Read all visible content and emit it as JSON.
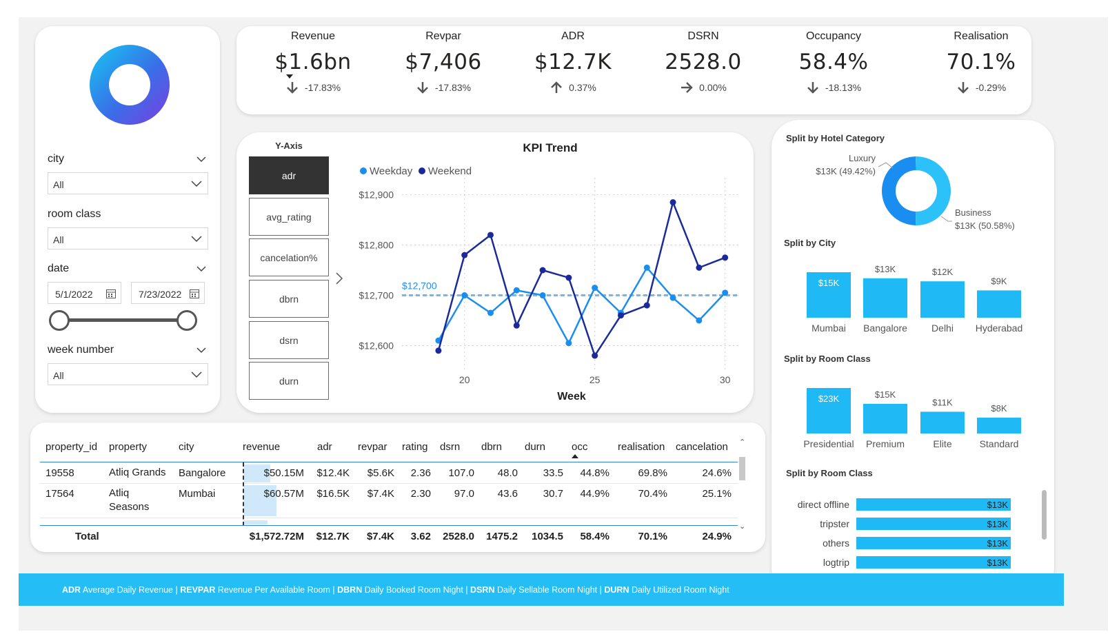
{
  "filters": {
    "city": {
      "label": "city",
      "value": "All"
    },
    "room_class": {
      "label": "room class",
      "value": "All"
    },
    "date": {
      "label": "date",
      "start": "5/1/2022",
      "end": "7/23/2022"
    },
    "week_number": {
      "label": "week number",
      "value": "All"
    }
  },
  "kpis": [
    {
      "title": "Revenue",
      "value": "$1.6bn",
      "delta": "-17.83%",
      "direction": "down"
    },
    {
      "title": "Revpar",
      "value": "$7,406",
      "delta": "-17.83%",
      "direction": "down"
    },
    {
      "title": "ADR",
      "value": "$12.7K",
      "delta": "0.37%",
      "direction": "up"
    },
    {
      "title": "DSRN",
      "value": "2528.0",
      "delta": "0.00%",
      "direction": "flat"
    },
    {
      "title": "Occupancy",
      "value": "58.4%",
      "delta": "-18.13%",
      "direction": "down"
    },
    {
      "title": "Realisation",
      "value": "70.1%",
      "delta": "-0.29%",
      "direction": "down"
    }
  ],
  "yaxis": {
    "title": "Y-Axis",
    "buttons": [
      "adr",
      "avg_rating",
      "cancelation%",
      "dbrn",
      "dsrn",
      "durn"
    ],
    "active": "adr"
  },
  "chart_data": [
    {
      "type": "line",
      "title": "KPI Trend",
      "xlabel": "Week",
      "ylabel": "",
      "x": [
        19,
        20,
        21,
        22,
        23,
        24,
        25,
        26,
        27,
        28,
        29,
        30
      ],
      "xticks": [
        "20",
        "25",
        "30"
      ],
      "yticks": [
        "$12,600",
        "$12,700",
        "$12,800",
        "$12,900"
      ],
      "ylim": [
        12565,
        12920
      ],
      "xlim": [
        17.6,
        30.3
      ],
      "reference_line": {
        "value": 12700,
        "label": "$12,700"
      },
      "series": [
        {
          "name": "Weekday",
          "color": "#1a8ef0",
          "values": [
            12610,
            12700,
            12665,
            12710,
            12700,
            12605,
            12715,
            12665,
            12755,
            12695,
            12650,
            12705
          ]
        },
        {
          "name": "Weekend",
          "color": "#1b2a9b",
          "values": [
            12590,
            12780,
            12820,
            12640,
            12750,
            12735,
            12580,
            12660,
            12680,
            12885,
            12755,
            12775
          ]
        }
      ]
    },
    {
      "type": "pie",
      "title": "Split by Hotel Category",
      "labels": [
        "Luxury",
        "Business"
      ],
      "values": [
        49.42,
        50.58
      ],
      "value_labels": [
        "$13K (49.42%)",
        "$13K (50.58%)"
      ],
      "colors": [
        "#1a8ef0",
        "#2cc1f8"
      ]
    },
    {
      "type": "bar",
      "title": "Split by City",
      "categories": [
        "Mumbai",
        "Bangalore",
        "Delhi",
        "Hyderabad"
      ],
      "values": [
        15,
        13,
        12,
        9
      ],
      "value_labels": [
        "$15K",
        "$13K",
        "$12K",
        "$9K"
      ],
      "ylim": [
        0,
        15
      ]
    },
    {
      "type": "bar",
      "title": "Split by Room Class",
      "categories": [
        "Presidential",
        "Premium",
        "Elite",
        "Standard"
      ],
      "values": [
        23,
        15,
        11,
        8
      ],
      "value_labels": [
        "$23K",
        "$15K",
        "$11K",
        "$8K"
      ],
      "ylim": [
        0,
        23
      ]
    },
    {
      "type": "bar",
      "orientation": "horizontal",
      "title": "Split by Room Class",
      "categories": [
        "direct offline",
        "tripster",
        "others",
        "logtrip"
      ],
      "values": [
        13,
        13,
        13,
        13
      ],
      "value_labels": [
        "$13K",
        "$13K",
        "$13K",
        "$13K"
      ]
    }
  ],
  "table": {
    "columns": [
      "property_id",
      "property",
      "city",
      "revenue",
      "adr",
      "revpar",
      "rating",
      "dsrn",
      "dbrn",
      "durn",
      "occ",
      "realisation",
      "cancelation"
    ],
    "rows": [
      {
        "property_id": "19558",
        "property": "Atliq Grands",
        "city": "Bangalore",
        "revenue": "$50.15M",
        "revenue_share": 0.32,
        "adr": "$12.4K",
        "revpar": "$5.6K",
        "rating": "2.36",
        "dsrn": "107.0",
        "dbrn": "48.0",
        "durn": "33.5",
        "occ": "44.8%",
        "realisation": "69.8%",
        "cancelation": "24.6%"
      },
      {
        "property_id": "17564",
        "property": "Atliq Seasons",
        "city": "Mumbai",
        "revenue": "$60.57M",
        "revenue_share": 0.39,
        "adr": "$16.5K",
        "revpar": "$7.4K",
        "rating": "2.30",
        "dsrn": "97.0",
        "dbrn": "43.6",
        "durn": "30.7",
        "occ": "44.9%",
        "realisation": "70.4%",
        "cancelation": "25.1%"
      }
    ],
    "total": {
      "label": "Total",
      "revenue": "$1,572.72M",
      "adr": "$12.7K",
      "revpar": "$7.4K",
      "rating": "3.62",
      "dsrn": "2528.0",
      "dbrn": "1475.2",
      "durn": "1034.5",
      "occ": "58.4%",
      "realisation": "70.1%",
      "cancelation": "24.9%"
    }
  },
  "footer": {
    "items": [
      {
        "abbr": "ADR",
        "text": "Average Daily Revenue"
      },
      {
        "abbr": "REVPAR",
        "text": "Revenue Per Available Room"
      },
      {
        "abbr": "DBRN",
        "text": "Daily Booked Room Night"
      },
      {
        "abbr": "DSRN",
        "text": "Daily Sellable Room Night"
      },
      {
        "abbr": "DURN",
        "text": "Daily Utilized Room Night"
      }
    ]
  },
  "colors": {
    "accent": "#24bdf6",
    "weekday": "#1a8ef0",
    "weekend": "#1b2a9b",
    "bar": "#1fb9f5"
  }
}
